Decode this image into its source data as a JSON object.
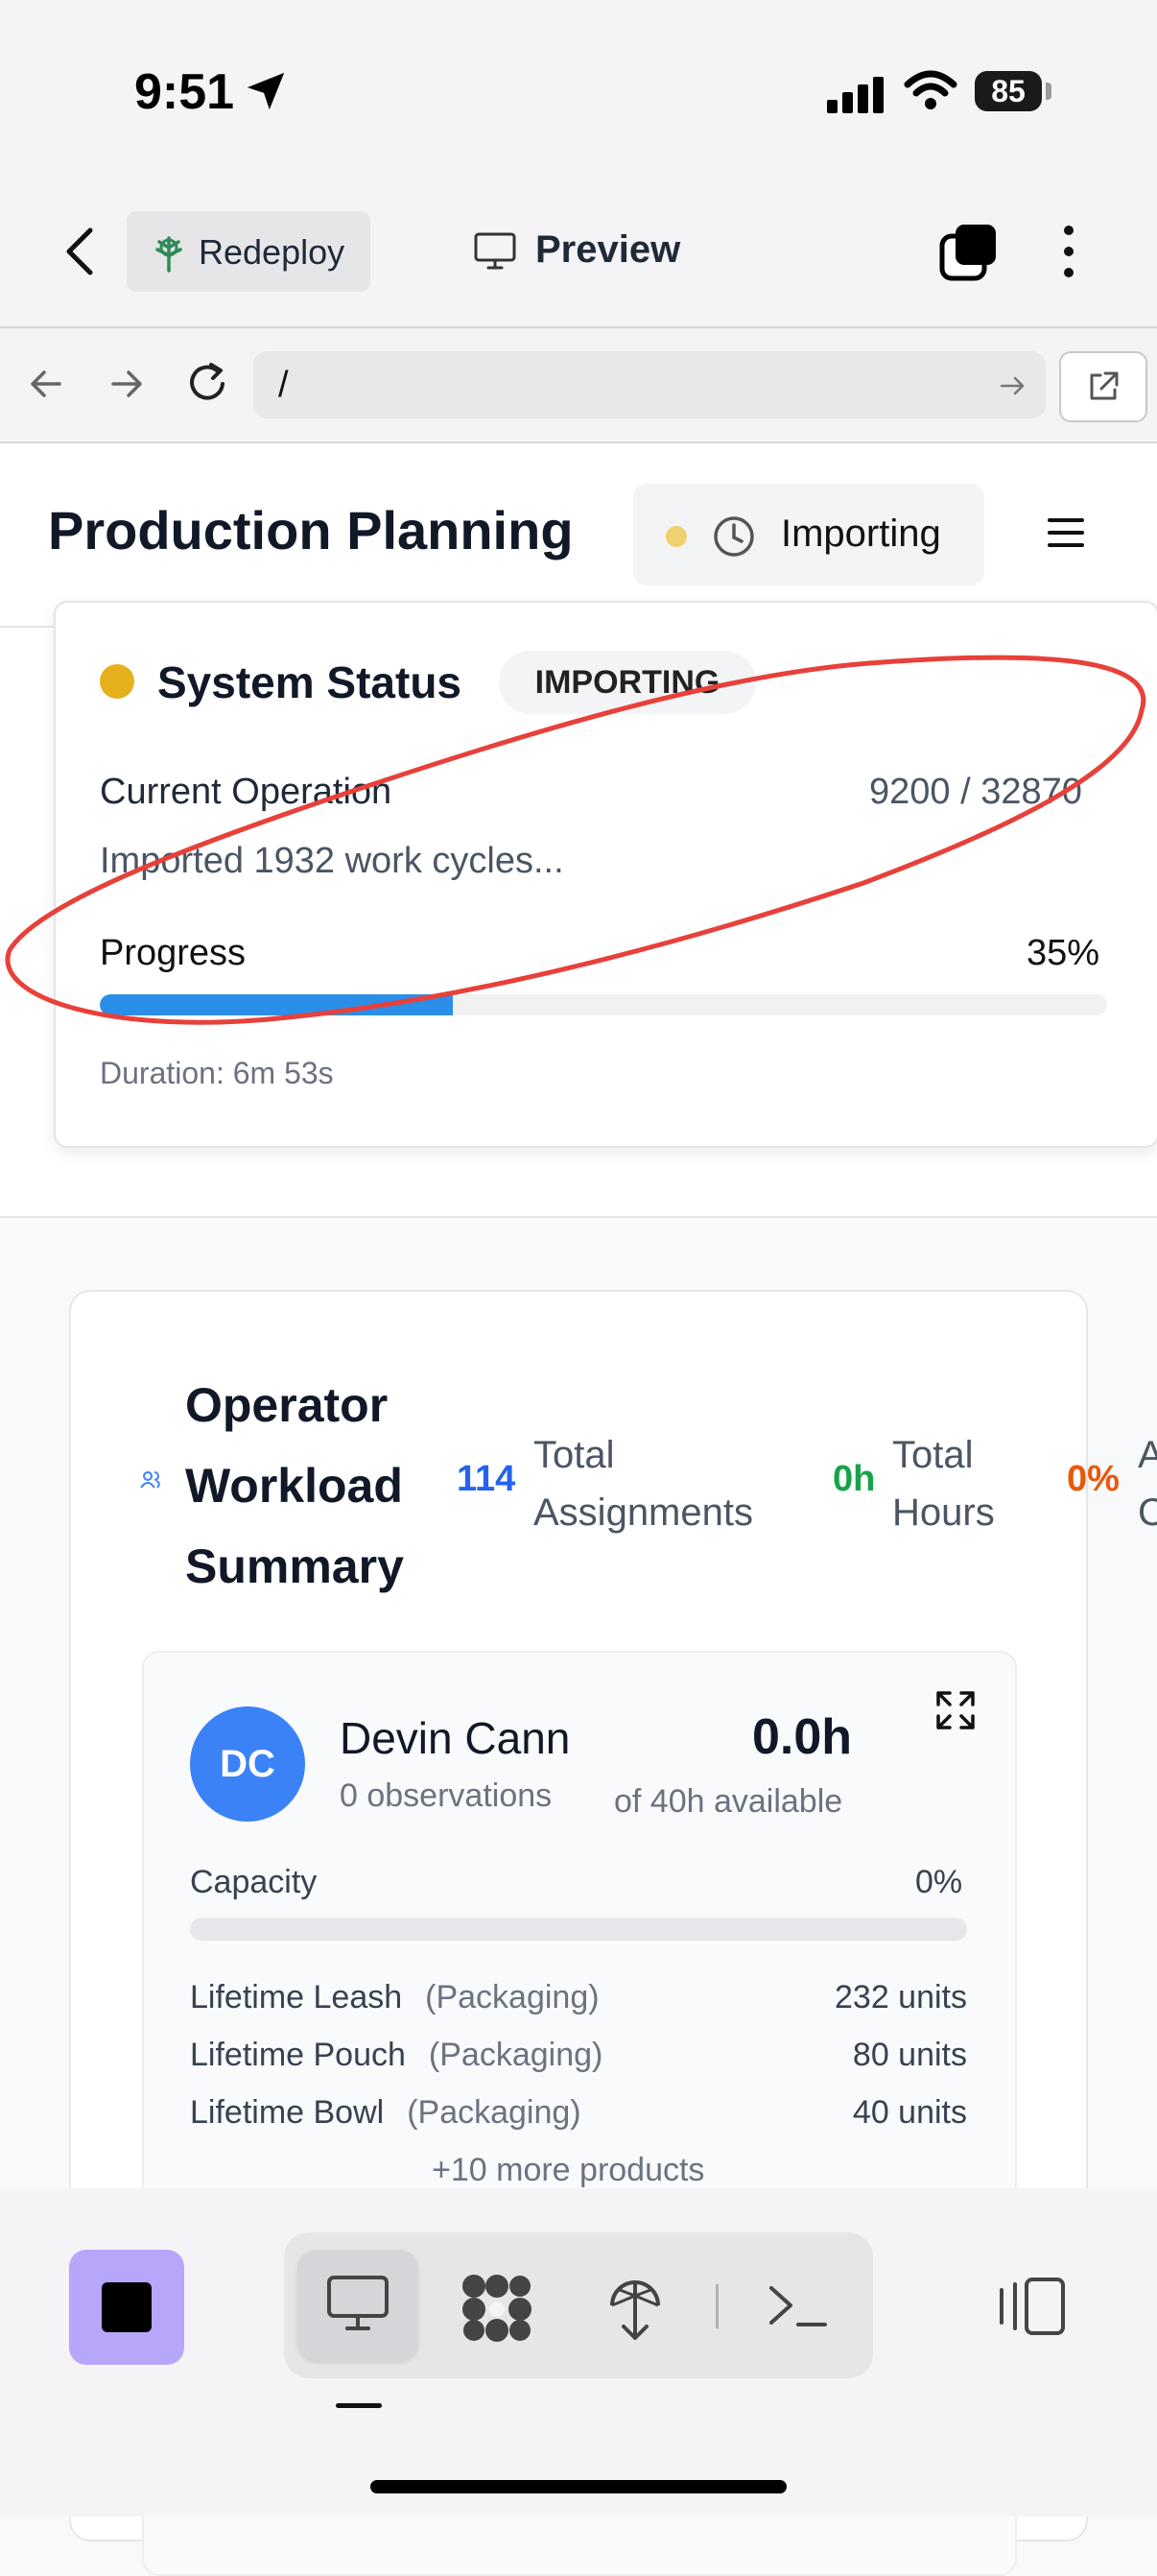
{
  "status_bar": {
    "time": "9:51",
    "battery": "85"
  },
  "app_header": {
    "redeploy_label": "Redeploy",
    "preview_label": "Preview"
  },
  "url_bar": {
    "path": "/"
  },
  "page": {
    "title": "Production Planning",
    "import_pill_label": "Importing"
  },
  "system_status": {
    "title": "System Status",
    "badge": "IMPORTING",
    "operation_label": "Current Operation",
    "operation_count": "9200 / 32870",
    "operation_message": "Imported 1932 work cycles...",
    "progress_label": "Progress",
    "progress_text": "35%",
    "progress_fraction": 0.35,
    "duration": "Duration: 6m 53s",
    "colors": {
      "dot": "#e6b01c",
      "progress": "#2b8ee8",
      "annotation": "#e8403a"
    }
  },
  "workload": {
    "title": "Operator Workload Summary",
    "metrics": [
      {
        "value": "114",
        "label": "Total Assignments",
        "color": "#2563eb"
      },
      {
        "value": "0h",
        "label": "Total Hours",
        "color": "#16a34a"
      },
      {
        "value": "0%",
        "label": "A C",
        "color": "#ea580c"
      }
    ],
    "operator": {
      "initials": "DC",
      "name": "Devin Cann",
      "observations": "0 observations",
      "hours": "0.0h",
      "available": "of 40h available",
      "capacity_label": "Capacity",
      "capacity_pct": "0%",
      "capacity_fraction": 0,
      "products": [
        {
          "name": "Lifetime Leash",
          "category": "(Packaging)",
          "units": "232 units"
        },
        {
          "name": "Lifetime Pouch",
          "category": "(Packaging)",
          "units": "80 units"
        },
        {
          "name": "Lifetime Bowl",
          "category": "(Packaging)",
          "units": "40 units"
        }
      ],
      "more": "+10 more products"
    }
  },
  "bottom_bar": {
    "tools": [
      "monitor-icon",
      "agents-icon",
      "deploy-icon",
      "terminal-icon"
    ],
    "stop_color": "#b8a6fb"
  }
}
